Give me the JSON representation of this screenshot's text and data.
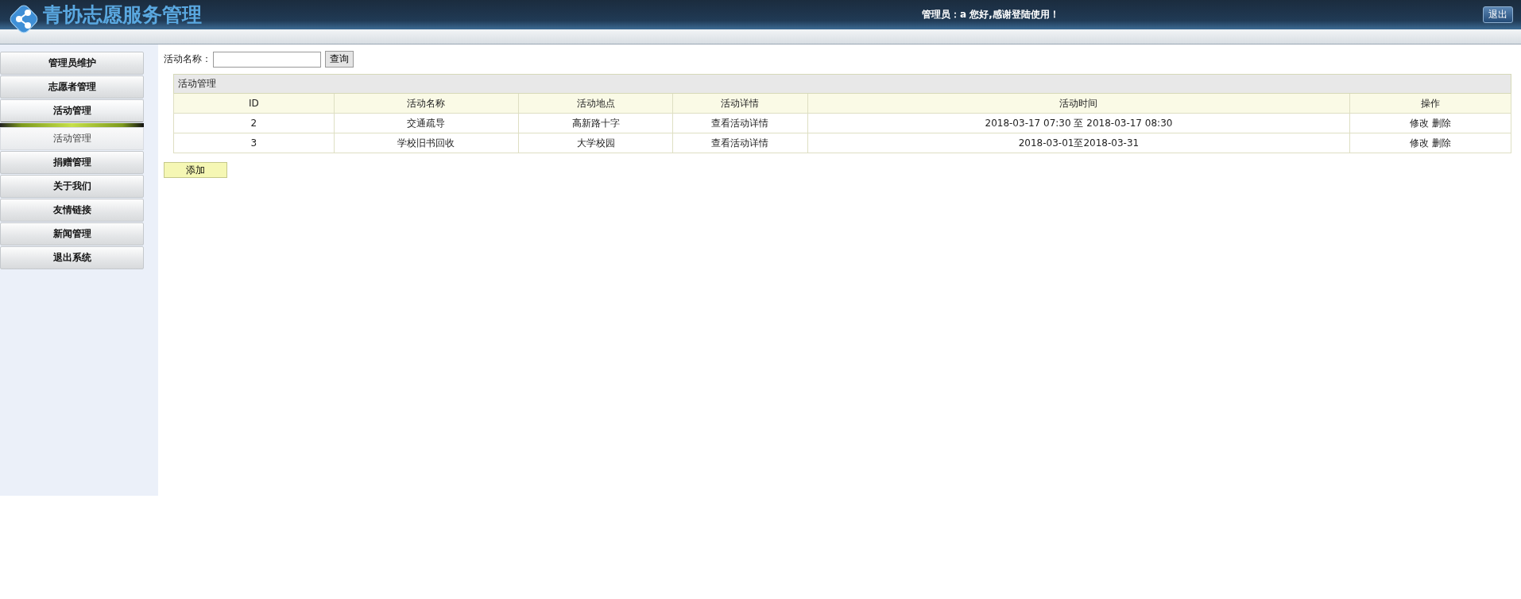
{
  "header": {
    "title": "青协志愿服务管理",
    "greeting": "管理员：a 您好,感谢登陆使用！",
    "logout": "退出"
  },
  "sidebar": {
    "items": [
      {
        "label": "管理员维护",
        "expanded": false
      },
      {
        "label": "志愿者管理",
        "expanded": false
      },
      {
        "label": "活动管理",
        "expanded": true,
        "children": [
          {
            "label": "活动管理"
          }
        ]
      },
      {
        "label": "捐赠管理",
        "expanded": false
      },
      {
        "label": "关于我们",
        "expanded": false
      },
      {
        "label": "友情链接",
        "expanded": false
      },
      {
        "label": "新闻管理",
        "expanded": false
      },
      {
        "label": "退出系统",
        "expanded": false
      }
    ]
  },
  "search": {
    "label": "活动名称：",
    "button": "查询"
  },
  "table": {
    "title": "活动管理",
    "columns": [
      "ID",
      "活动名称",
      "活动地点",
      "活动详情",
      "活动时间",
      "操作"
    ],
    "rows": [
      {
        "id": "2",
        "name": "交通疏导",
        "place": "高新路十字",
        "detail": "查看活动详情",
        "time": "2018-03-17 07:30 至 2018-03-17 08:30",
        "actions": [
          "修改",
          "删除"
        ]
      },
      {
        "id": "3",
        "name": "学校旧书回收",
        "place": "大学校园",
        "detail": "查看活动详情",
        "time": "2018-03-01至2018-03-31",
        "actions": [
          "修改",
          "删除"
        ]
      }
    ]
  },
  "add_button": "添加"
}
